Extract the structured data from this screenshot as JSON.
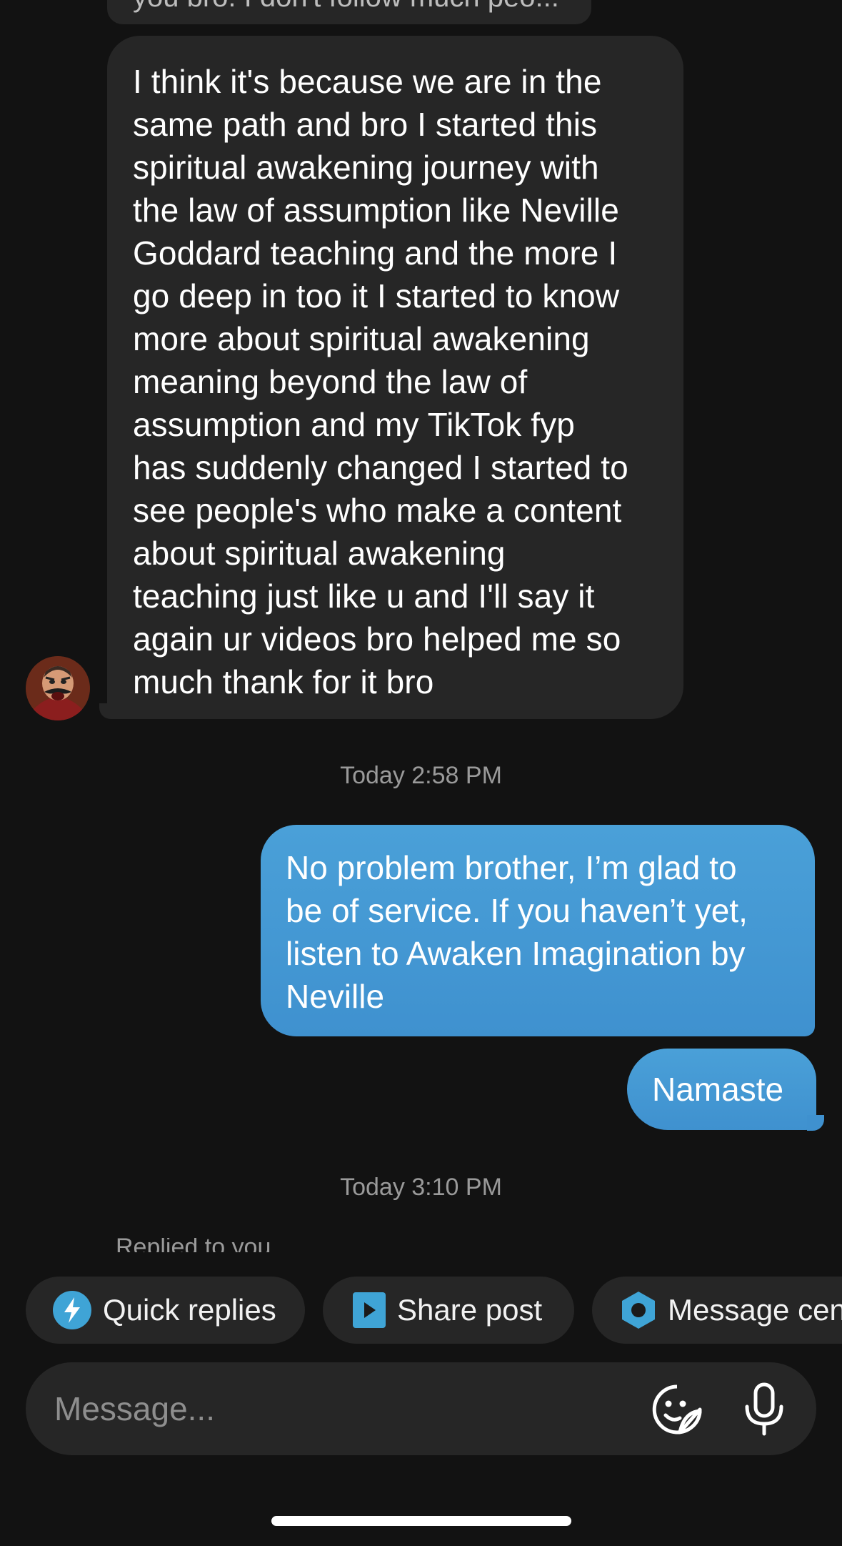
{
  "previous_message": {
    "text": "you bro. I don't follow much peo..."
  },
  "incoming_message": {
    "text": "I think it's because we are in the\nsame path and  bro I started this\nspiritual awakening journey with\nthe law of assumption like Neville\nGoddard teaching and the more I\ngo deep in too it I started to know\nmore about spiritual awakening\nmeaning beyond the law of\nassumption and my TikTok fyp\nhas suddenly changed I started to\nsee people's who make a content\nabout spiritual awakening\nteaching just like u and I'll say it\nagain ur videos bro helped me so\nmuch thank for it bro"
  },
  "timestamps": [
    "Today 2:58 PM",
    "Today 3:10 PM"
  ],
  "outgoing_messages": [
    "No problem brother, I’m glad to\nbe of service. If you haven’t yet,\nlisten to Awaken Imagination by\nNeville",
    "Namaste"
  ],
  "replied_label": "Replied to you",
  "quick_actions": [
    {
      "label": "Quick replies",
      "icon": "lightning-icon"
    },
    {
      "label": "Share post",
      "icon": "play-square-icon"
    },
    {
      "label": "Message cen",
      "icon": "hexagon-icon"
    }
  ],
  "composer": {
    "placeholder": "Message..."
  },
  "colors": {
    "background": "#121212",
    "incoming_bubble": "#262626",
    "outgoing_bubble": "#4298d4",
    "accent": "#3fa4d6"
  }
}
